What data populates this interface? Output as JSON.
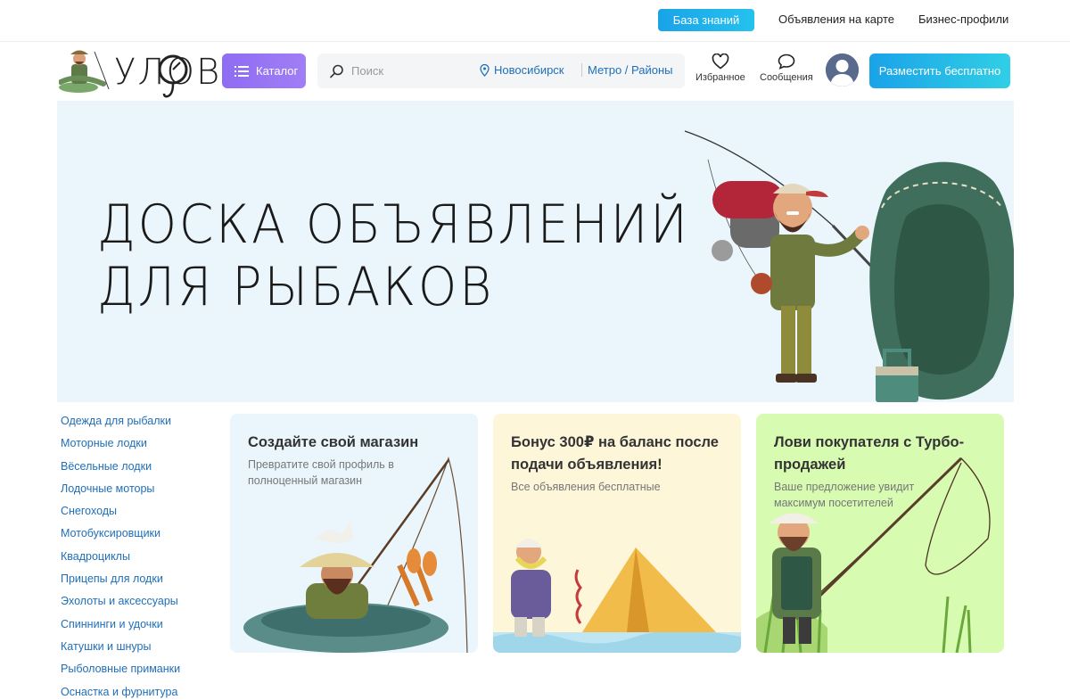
{
  "topbar": {
    "knowledge_base": "База знаний",
    "map_ads": "Объявления на карте",
    "business_profiles": "Бизнес-профили"
  },
  "header": {
    "logo_text": "УЛОВ",
    "catalog_label": "Каталог",
    "search_placeholder": "Поиск",
    "city": "Новосибирск",
    "metro": "Метро / Районы",
    "favorites_label": "Избранное",
    "messages_label": "Сообщения",
    "post_button": "Разместить бесплатно"
  },
  "hero": {
    "line1": "ДОСКА ОБЪЯВЛЕНИЙ",
    "line2": "ДЛЯ РЫБАКОВ"
  },
  "categories": [
    "Одежда для рыбалки",
    "Моторные лодки",
    "Вёсельные лодки",
    "Лодочные моторы",
    "Снегоходы",
    "Мотобуксировщики",
    "Квадроциклы",
    "Прицепы для лодки",
    "Эхолоты и аксессуары",
    "Спиннинги и удочки",
    "Катушки и шнуры",
    "Рыболовные приманки",
    "Оснастка и фурнитура"
  ],
  "cards": [
    {
      "title": "Создайте свой магазин",
      "subtitle": "Превратите свой профиль в полноценный магазин",
      "bg": "#eaf6fc"
    },
    {
      "title": "Бонус 300₽ на баланс после подачи объявления!",
      "subtitle": "Все объявления бесплатные",
      "bg": "#fdf6d9"
    },
    {
      "title": "Лови покупателя с Турбо-продажей",
      "subtitle": "Ваше предложение увидит максимум посетителей",
      "bg": "#d8fbb2"
    }
  ],
  "colors": {
    "accent_blue": "#1aa3e8",
    "catalog_purple": "#8f6cf2",
    "link_blue": "#1f6fb8"
  }
}
